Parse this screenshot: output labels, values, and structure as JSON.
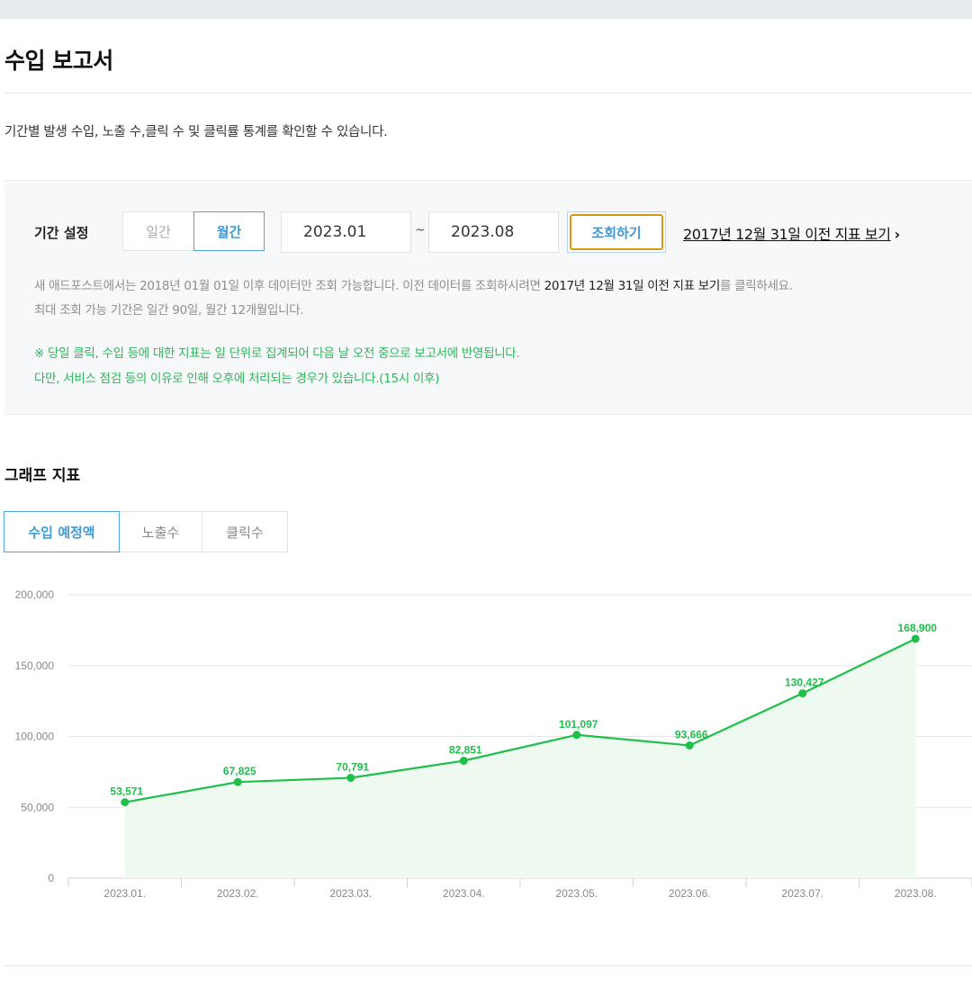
{
  "page": {
    "title": "수입 보고서",
    "description": "기간별 발생 수입, 노출 수,클릭 수 및 클릭률 통계를 확인할 수 있습니다."
  },
  "filter": {
    "label": "기간 설정",
    "daily_label": "일간",
    "monthly_label": "월간",
    "selected": "월간",
    "start_value": "2023.01",
    "separator": "~",
    "end_value": "2023.08",
    "search_label": "조회하기",
    "legacy_link": "2017년 12월 31일 이전 지표 보기",
    "legacy_chevron": "›",
    "notice1_pre": "새 애드포스트에서는 2018년 01월 01일 이후 데이터만 조회 가능합니다. 이전 데이터를 조회하시려면 ",
    "notice1_link": "2017년 12월 31일 이전 지표 보기",
    "notice1_post": "를 클릭하세요.",
    "notice2": "최대 조회 가능 기간은 일간 90일, 월간 12개월입니다.",
    "green1": "※ 당일 클릭, 수입 등에 대한 지표는 일 단위로 집계되어 다음 날 오전 중으로 보고서에 반영됩니다.",
    "green2": "다만, 서비스 점검 등의 이유로 인해 오후에 처리되는 경우가 있습니다.(15시 이후)"
  },
  "graph": {
    "section_title": "그래프 지표",
    "tabs": [
      {
        "label": "수입 예정액",
        "active": true
      },
      {
        "label": "노출수",
        "active": false
      },
      {
        "label": "클릭수",
        "active": false
      }
    ]
  },
  "colors": {
    "accent": "#3f9bd6",
    "line": "#1fbf4b",
    "fill": "#eefaf0",
    "highlight": "#d39a14",
    "notice_green": "#2fb45a"
  },
  "chart_data": {
    "type": "area",
    "categories": [
      "2023.01.",
      "2023.02.",
      "2023.03.",
      "2023.04.",
      "2023.05.",
      "2023.06.",
      "2023.07.",
      "2023.08."
    ],
    "values": [
      53571,
      67825,
      70791,
      82851,
      101097,
      93666,
      130427,
      168900
    ],
    "data_labels": [
      "53,571",
      "67,825",
      "70,791",
      "82,851",
      "101,097",
      "93,666",
      "130,427",
      "168,900"
    ],
    "y_ticks": [
      0,
      50000,
      100000,
      150000,
      200000
    ],
    "y_tick_labels": [
      "0",
      "50,000",
      "100,000",
      "150,000",
      "200,000"
    ],
    "ylim": [
      0,
      200000
    ],
    "grid": true,
    "legend": "none"
  }
}
